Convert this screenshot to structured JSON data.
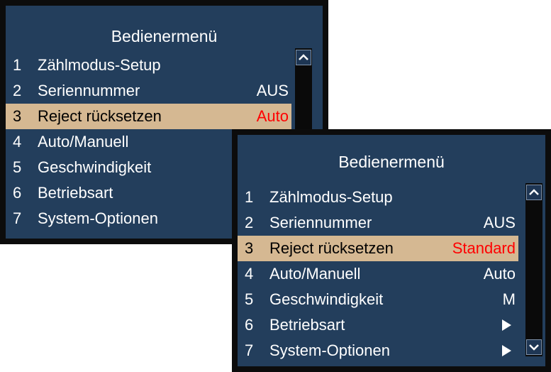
{
  "panels": [
    {
      "title": "Bedienermenü",
      "items": [
        {
          "num": "1",
          "label": "Zählmodus-Setup",
          "value": ""
        },
        {
          "num": "2",
          "label": "Seriennummer",
          "value": "AUS"
        },
        {
          "num": "3",
          "label": "Reject rücksetzen",
          "value": "Auto"
        },
        {
          "num": "4",
          "label": "Auto/Manuell",
          "value": ""
        },
        {
          "num": "5",
          "label": "Geschwindigkeit",
          "value": ""
        },
        {
          "num": "6",
          "label": "Betriebsart",
          "value": ""
        },
        {
          "num": "7",
          "label": "System-Optionen",
          "value": ""
        }
      ]
    },
    {
      "title": "Bedienermenü",
      "items": [
        {
          "num": "1",
          "label": "Zählmodus-Setup",
          "value": ""
        },
        {
          "num": "2",
          "label": "Seriennummer",
          "value": "AUS"
        },
        {
          "num": "3",
          "label": "Reject rücksetzen",
          "value": "Standard"
        },
        {
          "num": "4",
          "label": "Auto/Manuell",
          "value": "Auto"
        },
        {
          "num": "5",
          "label": "Geschwindigkeit",
          "value": "M"
        },
        {
          "num": "6",
          "label": "Betriebsart",
          "value": "",
          "icon": "submenu-arrow-icon"
        },
        {
          "num": "7",
          "label": "System-Optionen",
          "value": "",
          "icon": "submenu-arrow-icon"
        }
      ]
    }
  ],
  "colors": {
    "panel_bg": "#233e5c",
    "selected_bg": "#d5b892",
    "selected_value": "#ff0000",
    "text": "#ffffff"
  }
}
